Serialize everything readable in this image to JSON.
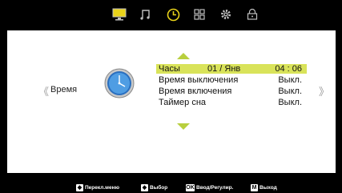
{
  "tabs": [
    {
      "icon": "picture-icon",
      "active": false
    },
    {
      "icon": "music-note-icon",
      "active": false
    },
    {
      "icon": "clock-icon",
      "active": true
    },
    {
      "icon": "grid-icon",
      "active": false
    },
    {
      "icon": "gear-icon",
      "active": false
    },
    {
      "icon": "lock-icon",
      "active": false
    }
  ],
  "colors": {
    "accent": "#d9e35a",
    "active_tab": "#e8d21a",
    "tab_icon": "#bfbfbf",
    "arrow": "#b8cf3e"
  },
  "category": {
    "label": "Время",
    "icon": "clock-icon"
  },
  "menu": {
    "items": [
      {
        "label": "Часы",
        "mid": "01 / Янв",
        "value": "04 : 06",
        "selected": true
      },
      {
        "label": "Время выключения",
        "value": "Выкл."
      },
      {
        "label": "Время включения",
        "value": "Выкл."
      },
      {
        "label": "Таймер сна",
        "value": "Выкл."
      }
    ]
  },
  "hints": [
    {
      "key": "◀▶",
      "label": "Перекл.меню"
    },
    {
      "key": "▲▼",
      "label": "Выбор"
    },
    {
      "key": "OK",
      "label": "Ввод/Регулир."
    },
    {
      "key": "M",
      "label": "Выход"
    }
  ]
}
